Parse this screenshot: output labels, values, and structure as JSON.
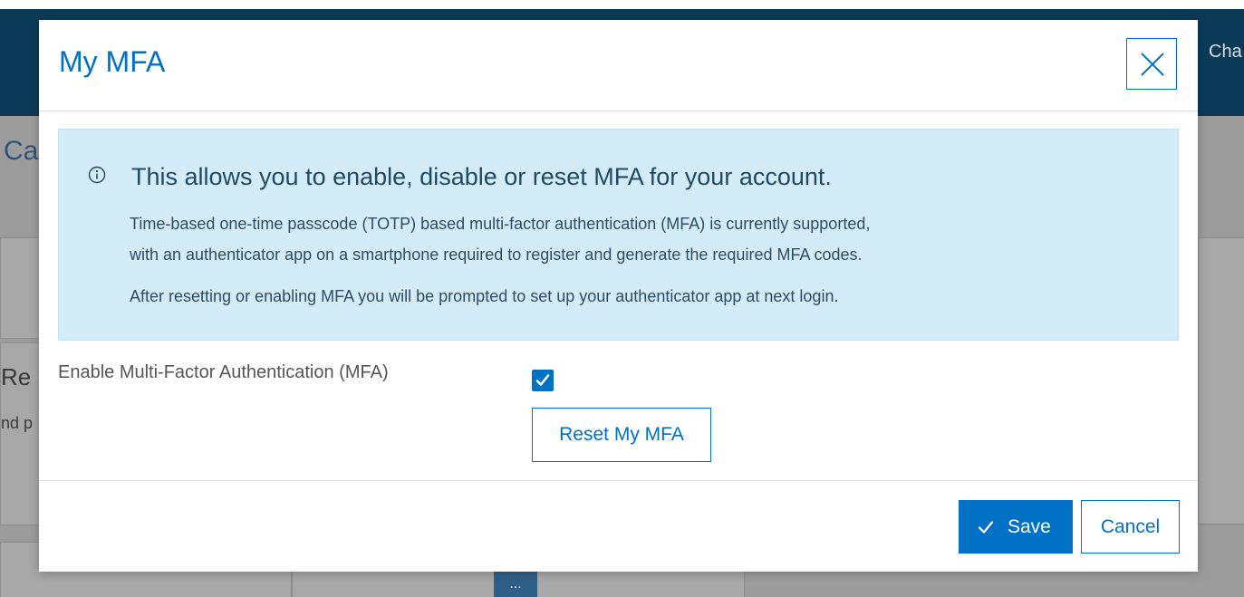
{
  "background": {
    "header_text": "Cha",
    "page_title": "Ca",
    "card_title": "Re",
    "card_subtitle": "nd p",
    "dots_label": "..."
  },
  "modal": {
    "title": "My MFA",
    "close_icon": "close-icon",
    "info": {
      "icon": "info-circle-icon",
      "heading": "This allows you to enable, disable or reset MFA for your account.",
      "paragraph_1_line_1": "Time-based one-time passcode (TOTP) based multi-factor authentication (MFA) is currently supported,",
      "paragraph_1_line_2": "with an authenticator app on a smartphone required to register and generate the required MFA codes.",
      "paragraph_2": "After resetting or enabling MFA you will be prompted to set up your authenticator app at next login."
    },
    "mfa_field": {
      "label": "Enable Multi-Factor Authentication (MFA)",
      "checked": true
    },
    "reset_button": "Reset My MFA",
    "footer": {
      "save_label": "Save",
      "cancel_label": "Cancel"
    }
  },
  "colors": {
    "accent": "#0071c5",
    "info_background": "#d4ecf7",
    "header_background": "#0b3a57"
  }
}
